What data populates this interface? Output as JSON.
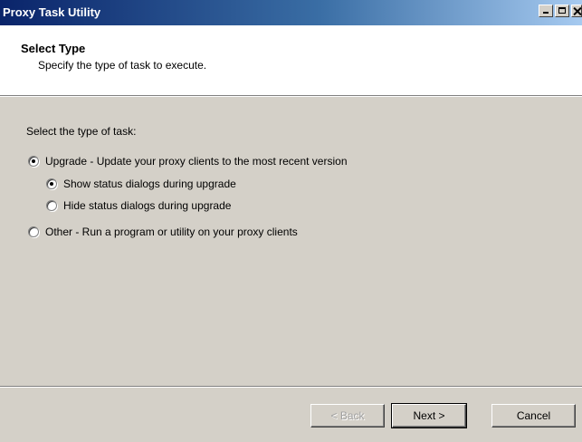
{
  "window": {
    "title": "Proxy Task Utility",
    "controls": [
      "minimize-icon",
      "maximize-icon",
      "close-icon"
    ]
  },
  "header": {
    "title": "Select Type",
    "subtitle": "Specify the type of task to execute."
  },
  "body": {
    "prompt": "Select the type of task:",
    "options": [
      {
        "label": "Upgrade - Update your proxy clients to the most recent version",
        "checked": true
      },
      {
        "label": "Show status dialogs during upgrade",
        "checked": true
      },
      {
        "label": "Hide status dialogs during upgrade",
        "checked": false
      },
      {
        "label": "Other - Run a program or utility on your proxy clients",
        "checked": false
      }
    ]
  },
  "buttons": {
    "back": "< Back",
    "next": "Next >",
    "cancel": "Cancel"
  },
  "colors": {
    "titlebar_start": "#0a246a",
    "titlebar_end": "#a6caf0",
    "dialog_bg": "#d4d0c8",
    "header_bg": "#ffffff"
  }
}
